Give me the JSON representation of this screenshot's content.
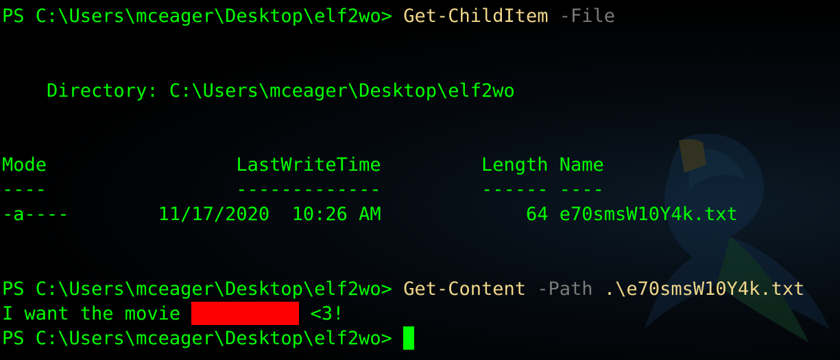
{
  "terminal": {
    "line1": {
      "prompt": "PS C:\\Users\\mceager\\Desktop\\elf2wo> ",
      "command": "Get-ChildItem",
      "param": " -File"
    },
    "directory_line": "    Directory: C:\\Users\\mceager\\Desktop\\elf2wo",
    "table": {
      "header": "Mode                 LastWriteTime         Length Name",
      "separator": "----                 -------------         ------ ----",
      "row": "-a----        11/17/2020  10:26 AM             64 e70smsW10Y4k.txt"
    },
    "line2": {
      "prompt": "PS C:\\Users\\mceager\\Desktop\\elf2wo> ",
      "command": "Get-Content",
      "param": " -Path",
      "arg": " .\\e70smsW10Y4k.txt"
    },
    "output": {
      "before_redaction": "I want the movie ",
      "after_redaction": " <3!"
    },
    "line3": {
      "prompt": "PS C:\\Users\\mceager\\Desktop\\elf2wo> "
    }
  },
  "colors": {
    "prompt": "#00ff00",
    "cmdlet": "#f1d78a",
    "parameter": "#7a7a7a",
    "redaction": "#ff0000",
    "background": "#000000"
  },
  "icons": {
    "background_watermark": "parrot-logo-icon"
  }
}
